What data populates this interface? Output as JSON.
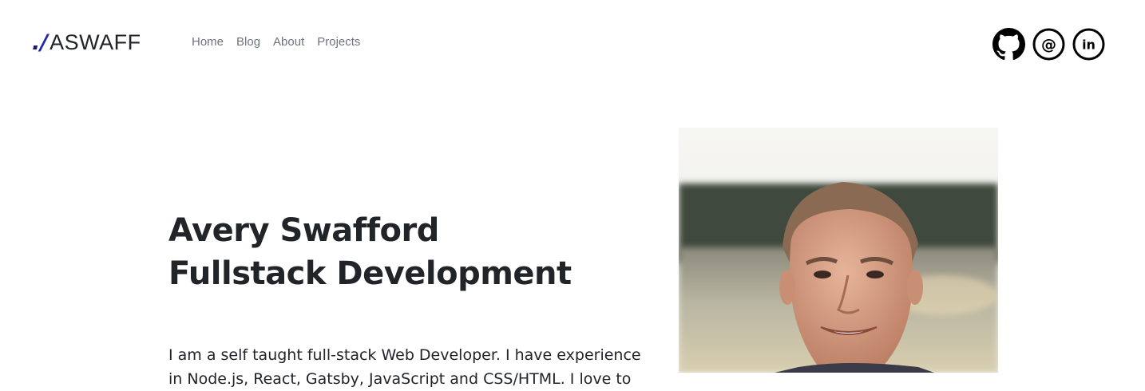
{
  "header": {
    "logo": {
      "dot": ".",
      "slash": "/",
      "text": "ASWAFF"
    },
    "nav": [
      {
        "label": "Home"
      },
      {
        "label": "Blog"
      },
      {
        "label": "About"
      },
      {
        "label": "Projects"
      }
    ],
    "socials": [
      {
        "icon": "github-icon"
      },
      {
        "icon": "email-at-icon",
        "glyph": "@"
      },
      {
        "icon": "linkedin-icon",
        "glyph": "in"
      }
    ]
  },
  "hero": {
    "name": "Avery Swafford",
    "role": "Fullstack Development",
    "intro": "I am a self taught full-stack Web Developer. I have experience in Node.js, React, Gatsby, JavaScript and CSS/HTML. I love to"
  },
  "colors": {
    "text": "#212529",
    "nav_text": "#6c757d",
    "logo_accent": "#2525a8",
    "logo_dot": "#18186e"
  }
}
